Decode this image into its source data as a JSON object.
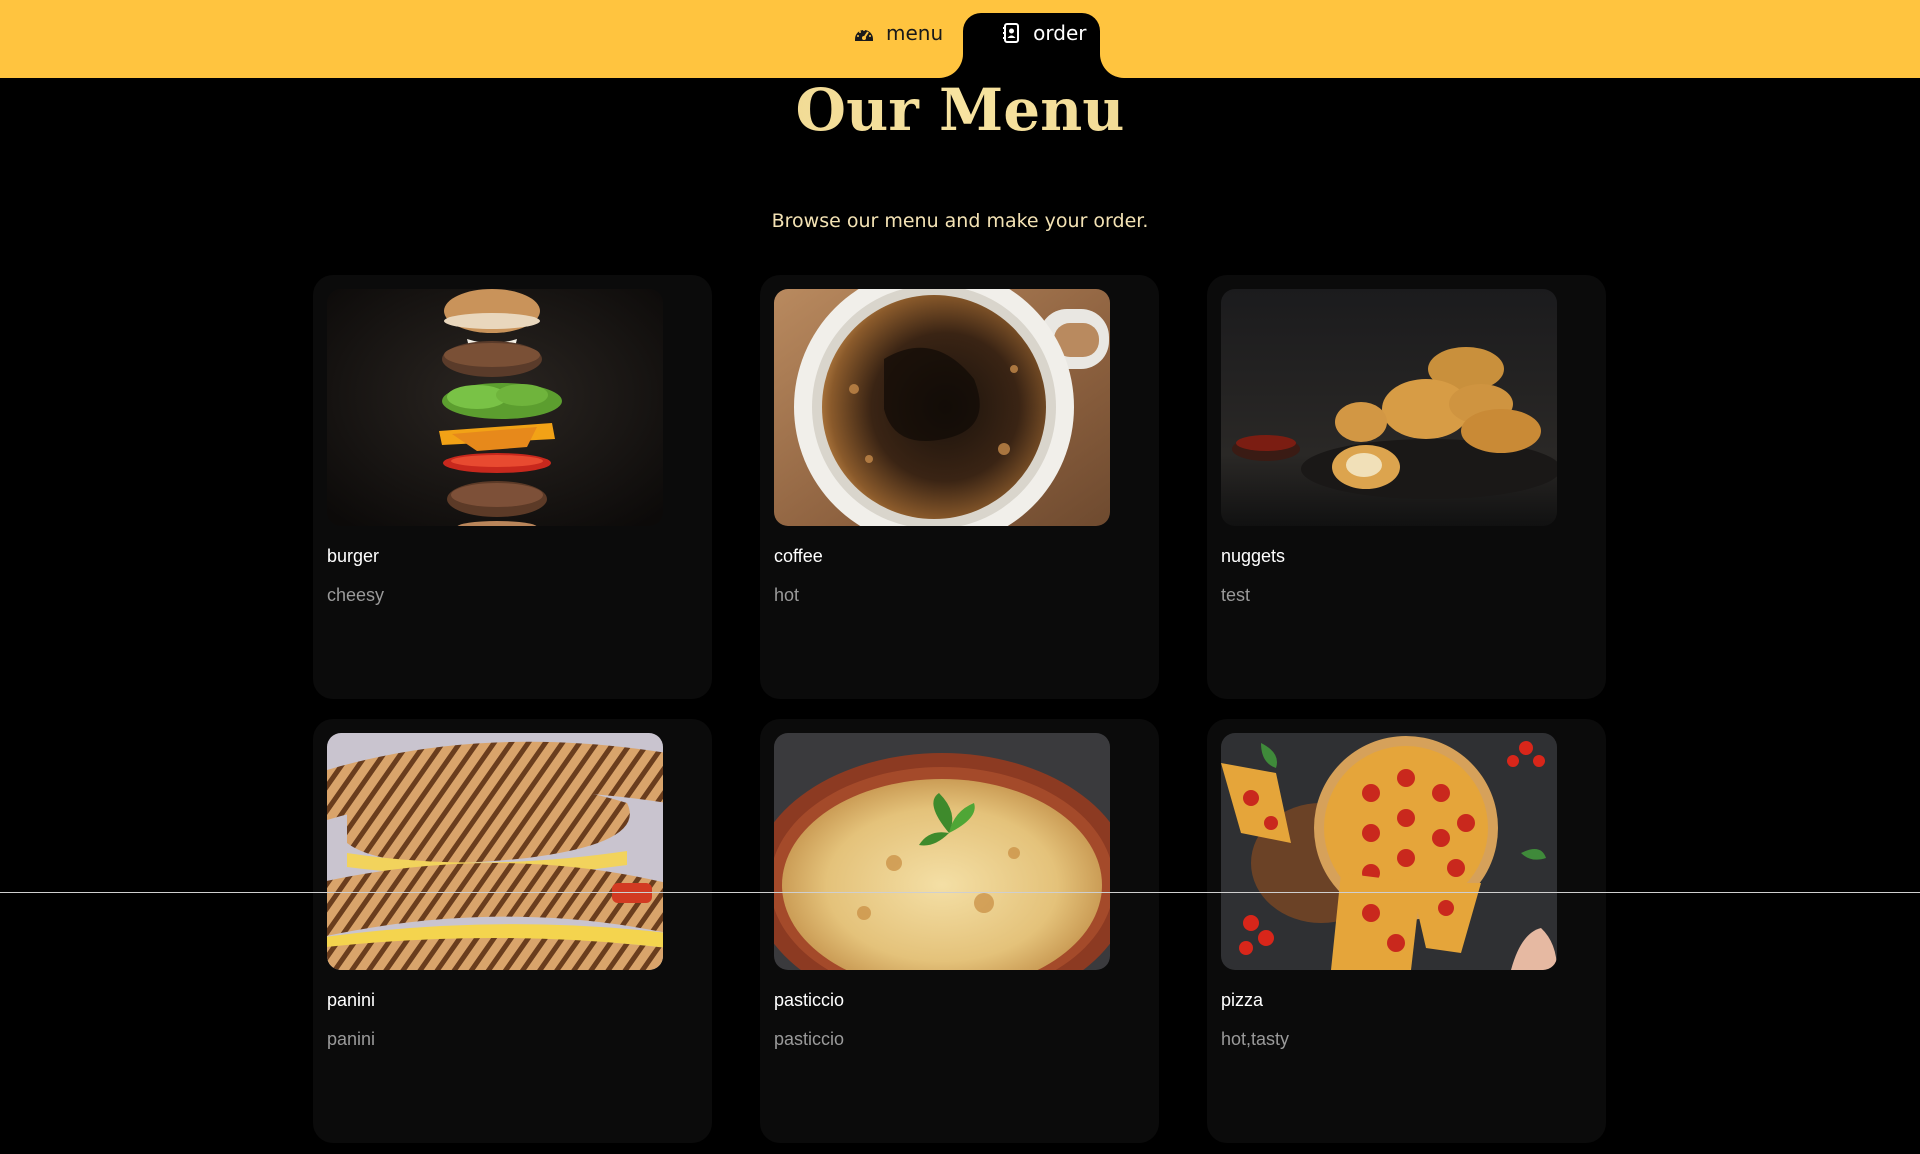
{
  "nav": {
    "items": [
      {
        "label": "menu",
        "icon": "dashboard-icon",
        "active": false
      },
      {
        "label": "order",
        "icon": "contact-book-icon",
        "active": true
      }
    ]
  },
  "header": {
    "title": "Our Menu",
    "subtitle": "Browse our menu and make your order."
  },
  "menu": {
    "items": [
      {
        "name": "burger",
        "description": "cheesy",
        "image": "burger-photo"
      },
      {
        "name": "coffee",
        "description": "hot",
        "image": "coffee-photo"
      },
      {
        "name": "nuggets",
        "description": "test",
        "image": "nuggets-photo"
      },
      {
        "name": "panini",
        "description": "panini",
        "image": "panini-photo"
      },
      {
        "name": "pasticcio",
        "description": "pasticcio",
        "image": "pasticcio-photo"
      },
      {
        "name": "pizza",
        "description": "hot,tasty",
        "image": "pizza-photo"
      }
    ]
  },
  "colors": {
    "topbar": "#ffc43f",
    "background": "#000000",
    "card": "#0b0b0b",
    "title_gold": "#e8c878",
    "subtitle": "#f3e2b4",
    "description": "#9a9a9a"
  }
}
